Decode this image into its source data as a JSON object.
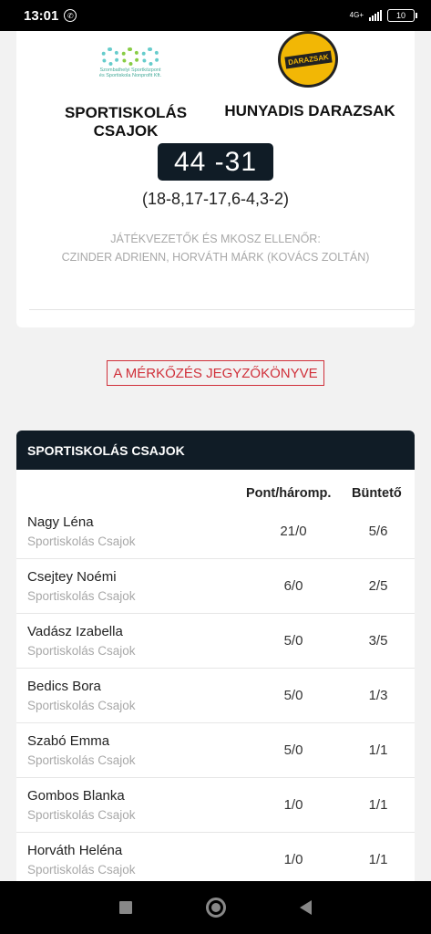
{
  "status_bar": {
    "time": "13:01",
    "network": "4G+",
    "battery": "10"
  },
  "match": {
    "home_logo_text": "Szombathelyi Sportközpont és Sportiskola Nonprofit Kft.",
    "away_logo_text": "DARAZSAK",
    "home_team": "SPORTISKOLÁS CSAJOK",
    "away_team": "HUNYADIS DARAZSAK",
    "score": "44 -31",
    "quarters": "(18-8,17-17,6-4,3-2)",
    "officials_title": "JÁTÉKVEZETŐK ÉS MKOSZ ELLENŐR:",
    "officials_names": "CZINDER ADRIENN, HORVÁTH MÁRK (KOVÁCS ZOLTÁN)"
  },
  "report_button": "A MÉRKŐZÉS JEGYZŐKÖNYVE",
  "stats": {
    "team_header": "SPORTISKOLÁS CSAJOK",
    "col_points": "Pont/háromp.",
    "col_fouls": "Büntető",
    "players": [
      {
        "name": "Nagy Léna",
        "team": "Sportiskolás Csajok",
        "points": "21/0",
        "fouls": "5/6"
      },
      {
        "name": "Csejtey Noémi",
        "team": "Sportiskolás Csajok",
        "points": "6/0",
        "fouls": "2/5"
      },
      {
        "name": "Vadász Izabella",
        "team": "Sportiskolás Csajok",
        "points": "5/0",
        "fouls": "3/5"
      },
      {
        "name": "Bedics Bora",
        "team": "Sportiskolás Csajok",
        "points": "5/0",
        "fouls": "1/3"
      },
      {
        "name": "Szabó Emma",
        "team": "Sportiskolás Csajok",
        "points": "5/0",
        "fouls": "1/1"
      },
      {
        "name": "Gombos Blanka",
        "team": "Sportiskolás Csajok",
        "points": "1/0",
        "fouls": "1/1"
      },
      {
        "name": "Horváth Heléna",
        "team": "Sportiskolás Csajok",
        "points": "1/0",
        "fouls": "1/1"
      }
    ]
  },
  "colors": {
    "dark": "#101c26",
    "accent_red": "#d0303a",
    "muted": "#a8a8a8"
  },
  "icons": {
    "status_call": "phone-call-icon",
    "nav_recents": "square-icon",
    "nav_home": "circle-icon",
    "nav_back": "triangle-back-icon"
  }
}
